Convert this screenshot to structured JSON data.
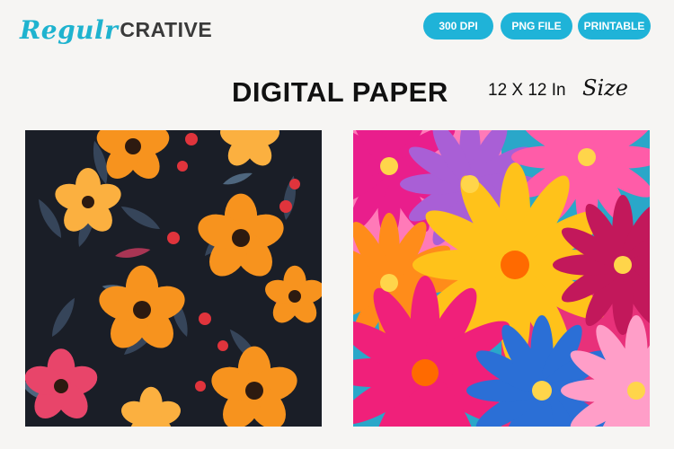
{
  "brand": {
    "script": "Regulr",
    "bold": "CRATIVE",
    "color": "#1fb3cf"
  },
  "badges": [
    "300 DPI",
    "PNG FILE",
    "PRINTABLE"
  ],
  "heading": {
    "title": "DIGITAL PAPER",
    "size_text": "12 X 12 In",
    "size_script": "Size"
  },
  "colors": {
    "accent": "#1fb3d8",
    "dark_panel_bg": "#1a1e27"
  }
}
